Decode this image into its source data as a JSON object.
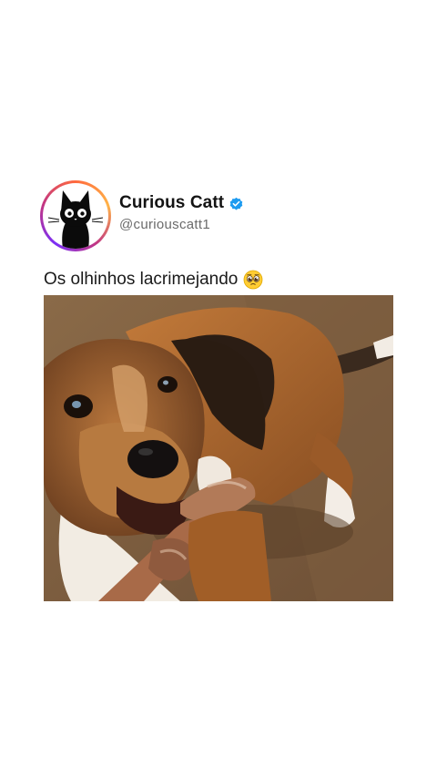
{
  "post": {
    "author": {
      "display_name": "Curious Catt",
      "handle": "@curiouscatt1",
      "verified": true,
      "avatar_icon": "black-cat-icon",
      "verified_icon": "verified-badge-icon"
    },
    "caption": {
      "text": "Os olhinhos lacrimejando",
      "emoji_icon": "pleading-face-emoji"
    },
    "media": {
      "type": "video-frame",
      "subject": "dog-image"
    }
  },
  "colors": {
    "verified_blue": "#1d9bf0",
    "text_primary": "#141414",
    "text_secondary": "#6b6b6b",
    "background": "#ffffff"
  }
}
